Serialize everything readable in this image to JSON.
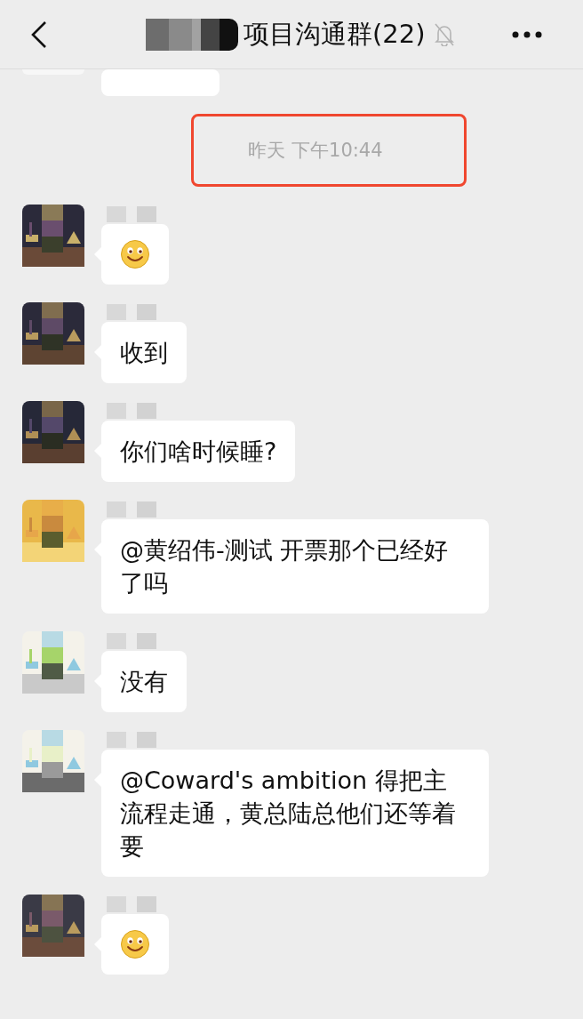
{
  "header": {
    "title": "项目沟通群(22)",
    "muted": true
  },
  "time_divider": {
    "text": "昨天 下午10:44",
    "highlighted": true
  },
  "messages": [
    {
      "kind": "emoji"
    },
    {
      "kind": "text",
      "text": "收到"
    },
    {
      "kind": "text",
      "text": "你们啥时候睡?"
    },
    {
      "kind": "text",
      "text": "@黄绍伟-测试 开票那个已经好了吗"
    },
    {
      "kind": "text",
      "text": "没有"
    },
    {
      "kind": "text",
      "text": "@Coward's ambition 得把主流程走通，黄总陆总他们还等着要"
    },
    {
      "kind": "emoji"
    }
  ]
}
